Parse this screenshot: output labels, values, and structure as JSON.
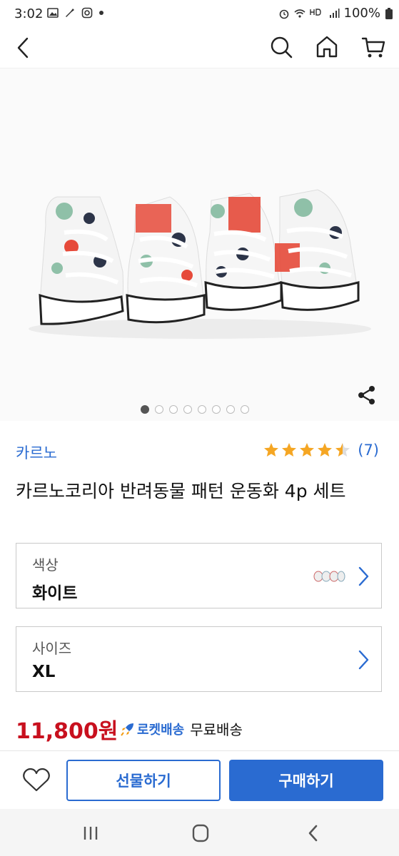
{
  "status_bar": {
    "time": "3:02",
    "battery": "100%",
    "icons": [
      "gallery-icon",
      "flight-icon",
      "instagram-icon",
      "dot-icon",
      "alarm-icon",
      "wifi-icon",
      "hd-voice-icon",
      "signal-icon",
      "battery-icon"
    ]
  },
  "header": {
    "icons": [
      "back-icon",
      "search-icon",
      "home-icon",
      "cart-icon"
    ]
  },
  "gallery": {
    "total_images": 8,
    "active_index": 0
  },
  "product": {
    "brand": "카르노",
    "rating": 4.5,
    "review_count": "(7)",
    "title": "카르노코리아 반려동물 패턴 운동화 4p 세트"
  },
  "options": [
    {
      "label": "색상",
      "value": "화이트"
    },
    {
      "label": "사이즈",
      "value": "XL"
    }
  ],
  "price": {
    "amount": "11,800원",
    "shipping_badge": "로켓배송",
    "shipping_text": "무료배송"
  },
  "actions": {
    "gift_label": "선물하기",
    "buy_label": "구매하기"
  },
  "colors": {
    "accent": "#2a6bd1",
    "price": "#c8101e",
    "star": "#f5a623"
  }
}
